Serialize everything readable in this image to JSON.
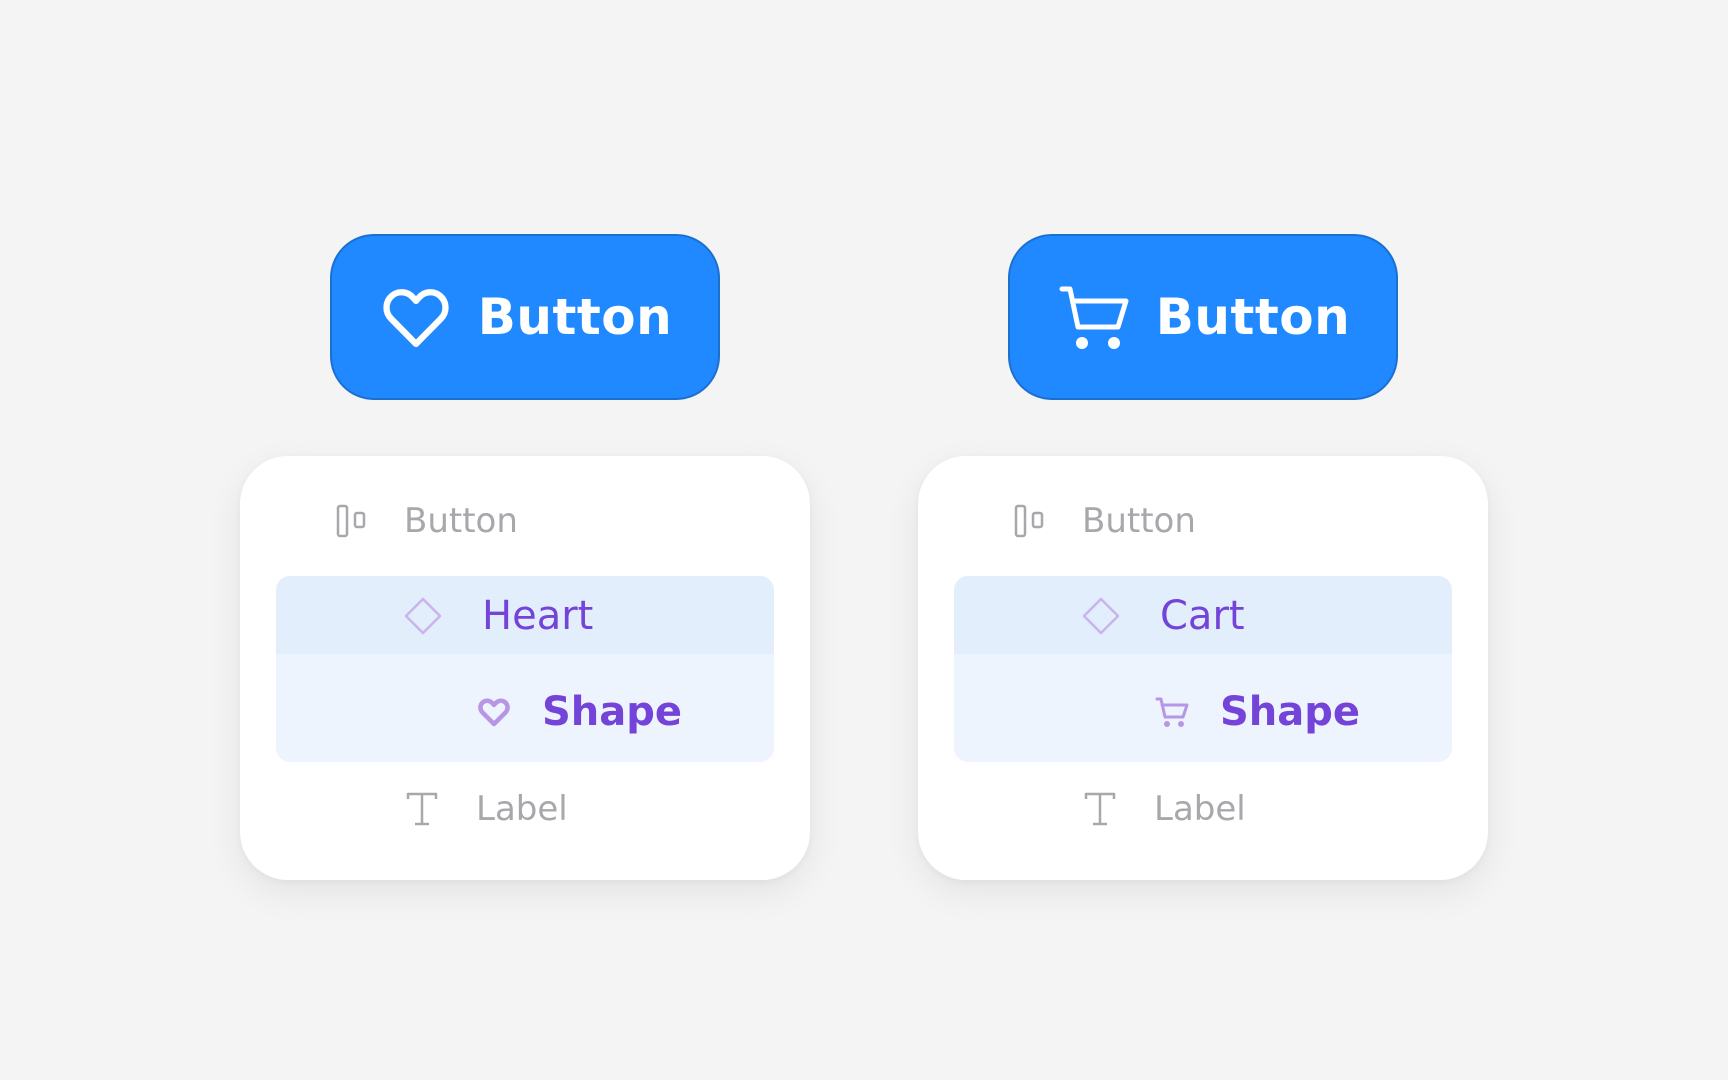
{
  "colors": {
    "background": "#f4f4f5",
    "button_fill": "#2189ff",
    "button_text": "#ffffff",
    "panel": "#ffffff",
    "selection_row": "#e3eefd",
    "selection_child": "#eef4fe",
    "accent_purple": "#7443d8",
    "muted_text": "#a8a8ac"
  },
  "examples": [
    {
      "button": {
        "label": "Button",
        "icon": "heart-icon"
      },
      "layers": {
        "root": {
          "label": "Button",
          "icon": "frame-layout-icon"
        },
        "component": {
          "label": "Heart",
          "icon": "component-diamond-icon"
        },
        "shape": {
          "label": "Shape",
          "icon": "heart-icon"
        },
        "text": {
          "label": "Label",
          "icon": "text-icon"
        }
      }
    },
    {
      "button": {
        "label": "Button",
        "icon": "cart-icon"
      },
      "layers": {
        "root": {
          "label": "Button",
          "icon": "frame-layout-icon"
        },
        "component": {
          "label": "Cart",
          "icon": "component-diamond-icon"
        },
        "shape": {
          "label": "Shape",
          "icon": "cart-icon"
        },
        "text": {
          "label": "Label",
          "icon": "text-icon"
        }
      }
    }
  ]
}
